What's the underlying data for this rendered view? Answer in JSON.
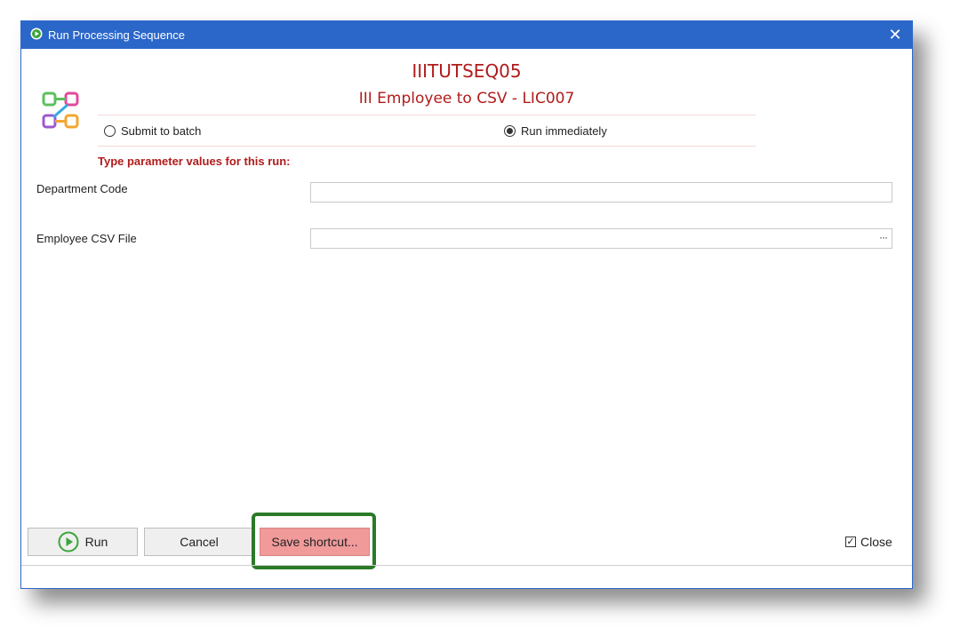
{
  "window": {
    "title": "Run Processing Sequence"
  },
  "sequence": {
    "code": "IIITUTSEQ05",
    "description": "III Employee to CSV - LIC007"
  },
  "run_mode": {
    "submit_label": "Submit to batch",
    "immediate_label": "Run immediately",
    "selected": "Run immediately"
  },
  "parameters": {
    "heading": "Type parameter values for this run:",
    "department_label": "Department Code",
    "department_value": "",
    "csv_label": "Employee CSV File",
    "csv_value": "",
    "browse_label": "···"
  },
  "buttons": {
    "run": "Run",
    "cancel": "Cancel",
    "save_shortcut": "Save shortcut...",
    "close": "Close",
    "close_checked": true
  },
  "colors": {
    "titlebar": "#2b67c9",
    "accent_red": "#b11b1b",
    "save_button": "#f19a9a",
    "highlight": "#2a7a27"
  }
}
